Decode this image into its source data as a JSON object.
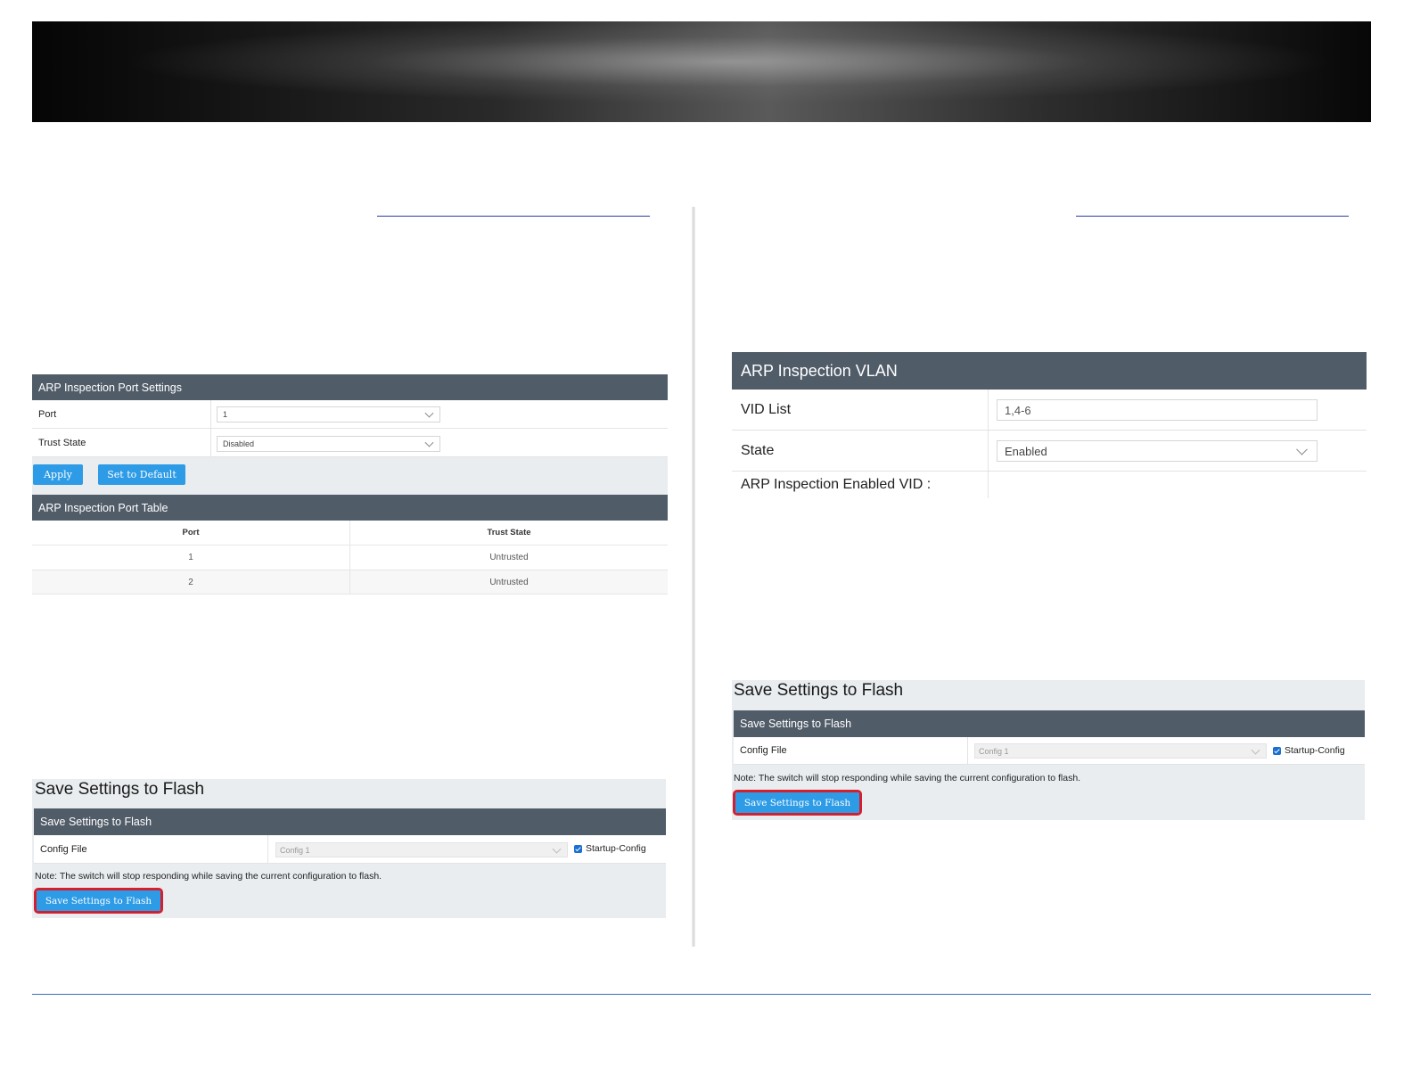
{
  "port_settings": {
    "header": "ARP Inspection Port Settings",
    "port_label": "Port",
    "port_value": "1",
    "trust_label": "Trust State",
    "trust_value": "Disabled",
    "apply_label": "Apply",
    "default_label": "Set to Default"
  },
  "port_table": {
    "header": "ARP Inspection Port Table",
    "columns": [
      "Port",
      "Trust State"
    ],
    "rows": [
      {
        "port": "1",
        "trust": "Untrusted"
      },
      {
        "port": "2",
        "trust": "Untrusted"
      }
    ]
  },
  "save_left": {
    "title": "Save Settings to Flash",
    "header": "Save Settings to Flash",
    "config_label": "Config File",
    "config_value": "Config 1",
    "startup_label": "Startup-Config",
    "note": "Note: The switch will stop responding while saving the current configuration to flash.",
    "button": "Save Settings to Flash"
  },
  "vlan": {
    "header": "ARP Inspection VLAN",
    "vid_label": "VID List",
    "vid_value": "1,4-6",
    "state_label": "State",
    "state_value": "Enabled",
    "enabled_vid_label": "ARP Inspection Enabled VID :"
  },
  "save_right": {
    "title": "Save Settings to Flash",
    "header": "Save Settings to Flash",
    "config_label": "Config File",
    "config_value": "Config 1",
    "startup_label": "Startup-Config",
    "note": "Note: The switch will stop responding while saving the current configuration to flash.",
    "button": "Save Settings to Flash"
  },
  "colors": {
    "header_bg": "#515c69",
    "button_bg": "#2d9be6",
    "highlight_outline": "#d3202e"
  }
}
